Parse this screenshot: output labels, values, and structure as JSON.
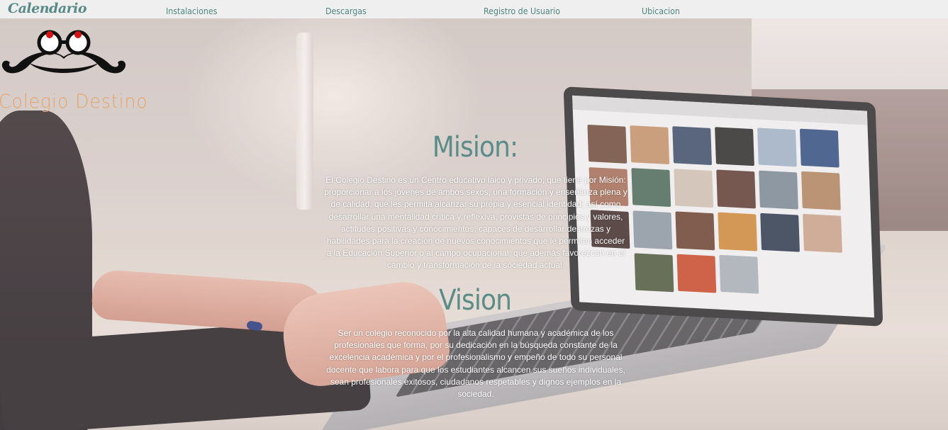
{
  "nav": {
    "brand": "Calendario",
    "links": [
      "Instalaciones",
      "Descargas",
      "Registro de Usuario",
      "Ubicacion"
    ]
  },
  "logo": {
    "icon": "mustache-glasses-icon",
    "title": "Colegio Destino"
  },
  "mision": {
    "heading": "Mision:",
    "text": "El Colegio Destino es un Centro educativo laico y privado, que tiene por Misión: proporcionar a los jóvenes de ambos sexos, una formación y enseñanza plena y de calidad, que les permita alcanzar su propia y esencial identidad; así como desarrollar una mentalidad crítica y reflexiva, provistas de principios y valores, actitudes positivas y conocimientos, capaces de desarrollar destrezas y habilidades para la creación de nuevos conocimientos que le permitan acceder a la Educación Superior o al campo ocupacional, que además favorezcan en el cambio y transformación de la sociedad actual."
  },
  "vision": {
    "heading": "Vision",
    "text": "Ser un colegio reconocido por la alta calidad humana y académica de los profesionales que forma, por su dedicación en la búsqueda constante de la excelencia académica y por el profesionalismo y empeño de todo su personal docente que labora para que los estudiantes alcancen sus sueños individuales, sean profesionales exitosos, ciudadanos respetables y dignos ejemplos en la sociedad."
  },
  "colors": {
    "accent": "#5b8c88",
    "logo_text": "#e4a56a",
    "nav_bg": "#efefef"
  }
}
